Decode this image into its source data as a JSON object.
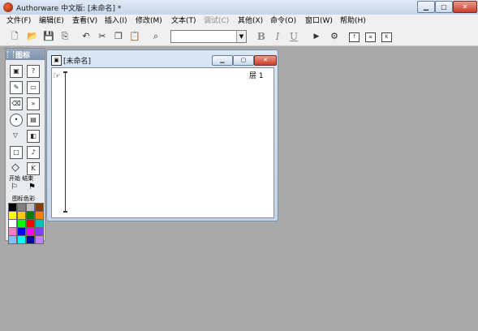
{
  "window": {
    "title": "Authorware 中文版: [未命名] *"
  },
  "menu": {
    "items": [
      {
        "label": "文件(F)",
        "enabled": true
      },
      {
        "label": "编辑(E)",
        "enabled": true
      },
      {
        "label": "查看(V)",
        "enabled": true
      },
      {
        "label": "插入(I)",
        "enabled": true
      },
      {
        "label": "修改(M)",
        "enabled": true
      },
      {
        "label": "文本(T)",
        "enabled": true
      },
      {
        "label": "调试(C)",
        "enabled": false
      },
      {
        "label": "其他(X)",
        "enabled": true
      },
      {
        "label": "命令(O)",
        "enabled": true
      },
      {
        "label": "窗口(W)",
        "enabled": true
      },
      {
        "label": "帮助(H)",
        "enabled": true
      }
    ]
  },
  "toolbar": {
    "font_value": "",
    "bold_label": "B",
    "italic_label": "I",
    "underline_label": "U",
    "icons": [
      "new-icon",
      "open-icon",
      "save-all-icon",
      "import-icon",
      "undo-icon",
      "cut-icon",
      "copy-icon",
      "paste-icon",
      "find-icon",
      "run-icon",
      "control-panel-icon",
      "functions-icon",
      "variables-icon",
      "knowledge-objects-icon"
    ]
  },
  "palette": {
    "title": "图标",
    "start_stop_label": "开始 结束",
    "color_label": "图标色彩",
    "icons": [
      "display-icon",
      "motion-icon",
      "erase-icon",
      "wait-icon",
      "navigate-icon",
      "framework-icon",
      "decision-icon",
      "interaction-icon",
      "calculation-icon",
      "map-icon",
      "digital-movie-icon",
      "sound-icon",
      "video-icon",
      "knowledge-object-icon"
    ],
    "swatches": [
      "#000000",
      "#808080",
      "#c0c0c0",
      "#804000",
      "#ffff00",
      "#ffcc00",
      "#008000",
      "#ff8000",
      "#ffffff",
      "#00ff00",
      "#ff0000",
      "#00c0c0",
      "#ff80c0",
      "#0000ff",
      "#ff00ff",
      "#8040ff",
      "#80c0ff",
      "#00ffff",
      "#0000a0",
      "#c080ff"
    ]
  },
  "child_window": {
    "title": "[未命名]",
    "level_label": "层 1"
  },
  "colors": {
    "workspace": "#a9a9a9",
    "canvas": "#ffffff"
  }
}
